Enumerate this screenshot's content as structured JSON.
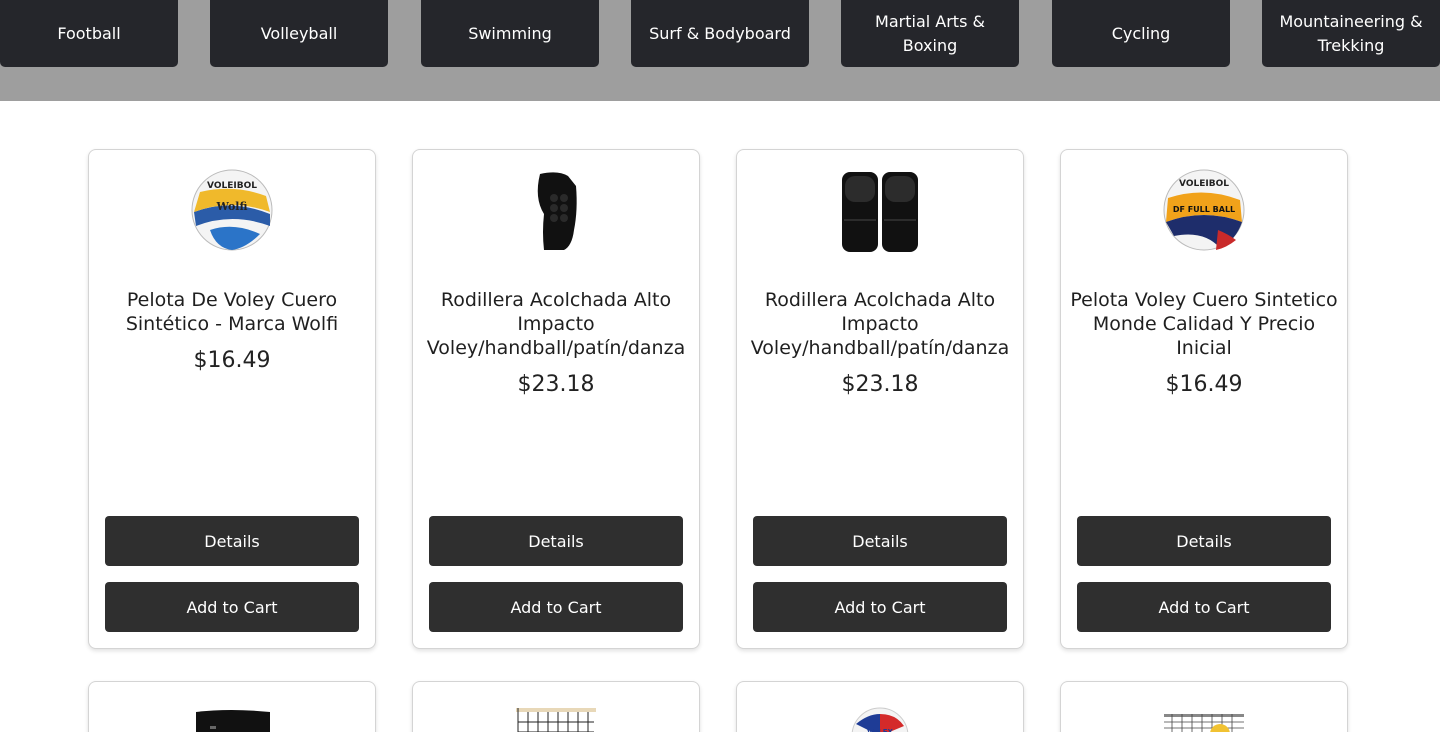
{
  "categories": [
    {
      "label": "Football"
    },
    {
      "label": "Volleyball"
    },
    {
      "label": "Swimming"
    },
    {
      "label": "Surf & Bodyboard"
    },
    {
      "label": "Martial Arts & Boxing"
    },
    {
      "label": "Cycling"
    },
    {
      "label": "Mountaineering & Trekking"
    }
  ],
  "products": [
    {
      "title": "Pelota De Voley Cuero Sintético - Marca Wolfi",
      "price": "$16.49",
      "details_label": "Details",
      "cart_label": "Add to Cart",
      "image": "volleyball-ball-wolfi"
    },
    {
      "title": "Rodillera Acolchada Alto Impacto Voley/handball/patín/danza",
      "price": "$23.18",
      "details_label": "Details",
      "cart_label": "Add to Cart",
      "image": "knee-pad-single"
    },
    {
      "title": "Rodillera Acolchada Alto Impacto Voley/handball/patín/danza",
      "price": "$23.18",
      "details_label": "Details",
      "cart_label": "Add to Cart",
      "image": "knee-pads-pair"
    },
    {
      "title": "Pelota Voley Cuero Sintetico Monde Calidad Y Precio Inicial",
      "price": "$16.49",
      "details_label": "Details",
      "cart_label": "Add to Cart",
      "image": "volleyball-ball-full"
    }
  ],
  "next_row_images": [
    "black-sleeve",
    "volleyball-net",
    "volleyball-ball-volex",
    "volleyball-net-ball"
  ],
  "colors": {
    "category_bg": "#25262b",
    "category_bar": "#9e9e9e",
    "button_bg": "#2f2f2f"
  }
}
